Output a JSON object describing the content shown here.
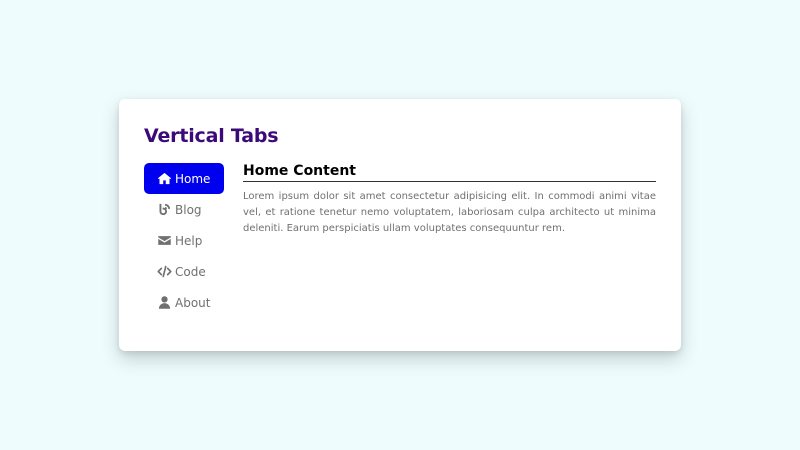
{
  "title": "Vertical Tabs",
  "tabs": [
    {
      "label": "Home",
      "icon": "home-icon",
      "active": true
    },
    {
      "label": "Blog",
      "icon": "blog-icon",
      "active": false
    },
    {
      "label": "Help",
      "icon": "envelope-icon",
      "active": false
    },
    {
      "label": "Code",
      "icon": "code-icon",
      "active": false
    },
    {
      "label": "About",
      "icon": "user-icon",
      "active": false
    }
  ],
  "content": {
    "heading": "Home Content",
    "body": "Lorem ipsum dolor sit amet consectetur adipisicing elit. In commodi animi vitae vel, et ratione tenetur nemo voluptatem, laboriosam culpa architecto ut minima deleniti. Earum perspiciatis ullam voluptates consequuntur rem."
  },
  "colors": {
    "background": "#eefcfe",
    "accent": "#0000ee",
    "title": "#3b0a78"
  }
}
